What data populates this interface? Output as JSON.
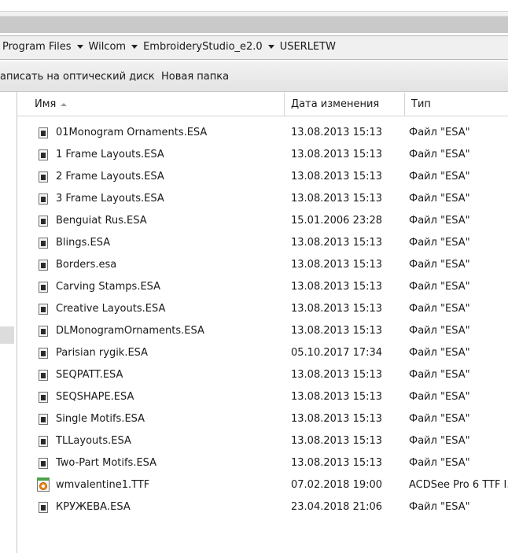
{
  "address": {
    "crumbs": [
      "Program Files",
      "Wilcom",
      "EmbroideryStudio_e2.0",
      "USERLETW"
    ]
  },
  "toolbar": {
    "burn_label": "аписать на оптический диск",
    "new_folder_label": "Новая папка"
  },
  "columns": {
    "name": "Имя",
    "date": "Дата изменения",
    "type": "Тип"
  },
  "files": [
    {
      "name": "01Monogram Ornaments.ESA",
      "date": "13.08.2013 15:13",
      "type": "Файл \"ESA\"",
      "icon": "esa-file-icon"
    },
    {
      "name": "1 Frame Layouts.ESA",
      "date": "13.08.2013 15:13",
      "type": "Файл \"ESA\"",
      "icon": "esa-file-icon"
    },
    {
      "name": "2 Frame Layouts.ESA",
      "date": "13.08.2013 15:13",
      "type": "Файл \"ESA\"",
      "icon": "esa-file-icon"
    },
    {
      "name": "3 Frame Layouts.ESA",
      "date": "13.08.2013 15:13",
      "type": "Файл \"ESA\"",
      "icon": "esa-file-icon"
    },
    {
      "name": "Benguiat Rus.ESA",
      "date": "15.01.2006 23:28",
      "type": "Файл \"ESA\"",
      "icon": "esa-file-icon"
    },
    {
      "name": "Blings.ESA",
      "date": "13.08.2013 15:13",
      "type": "Файл \"ESA\"",
      "icon": "esa-file-icon"
    },
    {
      "name": "Borders.esa",
      "date": "13.08.2013 15:13",
      "type": "Файл \"ESA\"",
      "icon": "esa-file-icon"
    },
    {
      "name": "Carving Stamps.ESA",
      "date": "13.08.2013 15:13",
      "type": "Файл \"ESA\"",
      "icon": "esa-file-icon"
    },
    {
      "name": "Creative Layouts.ESA",
      "date": "13.08.2013 15:13",
      "type": "Файл \"ESA\"",
      "icon": "esa-file-icon"
    },
    {
      "name": "DLMonogramOrnaments.ESA",
      "date": "13.08.2013 15:13",
      "type": "Файл \"ESA\"",
      "icon": "esa-file-icon"
    },
    {
      "name": "Parisian rygik.ESA",
      "date": "05.10.2017 17:34",
      "type": "Файл \"ESA\"",
      "icon": "esa-file-icon"
    },
    {
      "name": "SEQPATT.ESA",
      "date": "13.08.2013 15:13",
      "type": "Файл \"ESA\"",
      "icon": "esa-file-icon"
    },
    {
      "name": "SEQSHAPE.ESA",
      "date": "13.08.2013 15:13",
      "type": "Файл \"ESA\"",
      "icon": "esa-file-icon"
    },
    {
      "name": "Single Motifs.ESA",
      "date": "13.08.2013 15:13",
      "type": "Файл \"ESA\"",
      "icon": "esa-file-icon"
    },
    {
      "name": "TLLayouts.ESA",
      "date": "13.08.2013 15:13",
      "type": "Файл \"ESA\"",
      "icon": "esa-file-icon"
    },
    {
      "name": "Two-Part Motifs.ESA",
      "date": "13.08.2013 15:13",
      "type": "Файл \"ESA\"",
      "icon": "esa-file-icon"
    },
    {
      "name": "wmvalentine1.TTF",
      "date": "07.02.2018 19:00",
      "type": "ACDSee Pro 6 TTF I...",
      "icon": "ttf-font-file-icon"
    },
    {
      "name": "КРУЖЕВА.ESA",
      "date": "23.04.2018 21:06",
      "type": "Файл \"ESA\"",
      "icon": "esa-file-icon"
    }
  ]
}
